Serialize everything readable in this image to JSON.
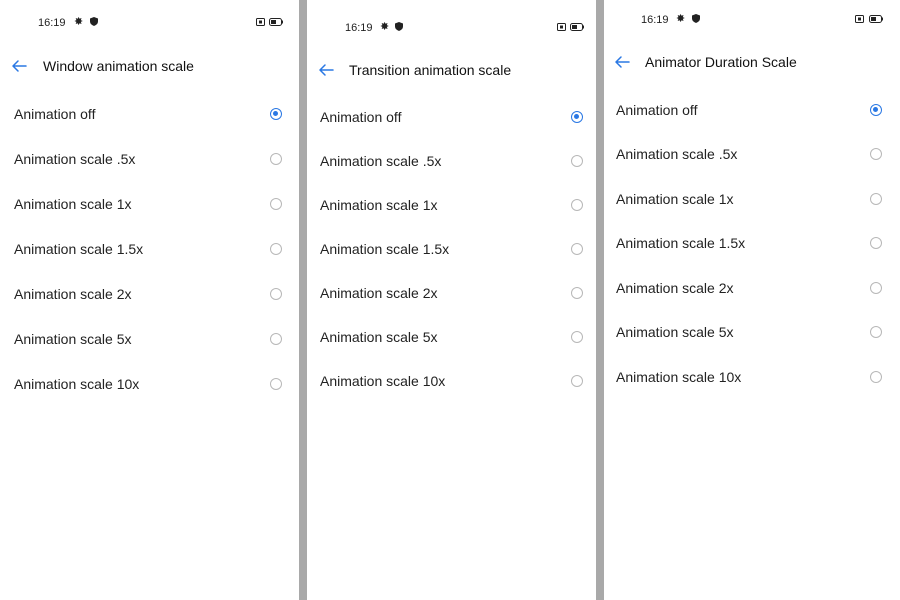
{
  "status_bar": {
    "time": "16:19",
    "icons": [
      "gear-icon",
      "shield-icon",
      "screen-icon",
      "battery-icon"
    ]
  },
  "accent_color": "#2a78e4",
  "panels": [
    {
      "title": "Window animation scale",
      "selected_index": 0,
      "options": [
        "Animation off",
        "Animation scale .5x",
        "Animation scale 1x",
        "Animation scale 1.5x",
        "Animation scale 2x",
        "Animation scale 5x",
        "Animation scale 10x"
      ]
    },
    {
      "title": "Transition animation scale",
      "selected_index": 0,
      "options": [
        "Animation off",
        "Animation scale .5x",
        "Animation scale 1x",
        "Animation scale 1.5x",
        "Animation scale 2x",
        "Animation scale 5x",
        "Animation scale 10x"
      ]
    },
    {
      "title": "Animator Duration Scale",
      "selected_index": 0,
      "options": [
        "Animation off",
        "Animation scale .5x",
        "Animation scale 1x",
        "Animation scale 1.5x",
        "Animation scale 2x",
        "Animation scale 5x",
        "Animation scale 10x"
      ]
    }
  ]
}
